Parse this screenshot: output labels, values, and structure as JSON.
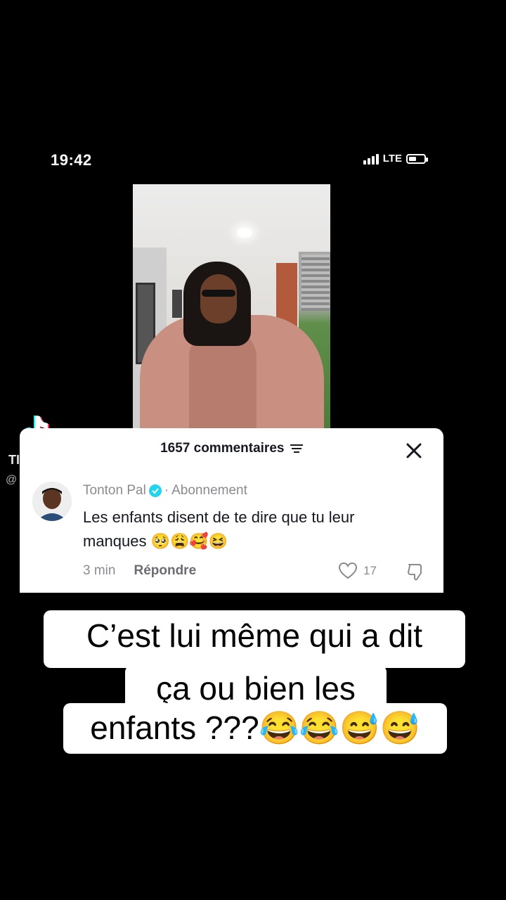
{
  "status_bar": {
    "time": "19:42",
    "network": "LTE",
    "battery_level": 0.5
  },
  "video": {
    "description_icon": "video-frame"
  },
  "tiktok": {
    "name": "TIKTOK",
    "handle": "@"
  },
  "comments": {
    "count_label": "1657 commentaires",
    "comment": {
      "author": "Tonton Pal",
      "separator": "·",
      "follow_label": "Abonnement",
      "line1": "Les enfants disent de te dire que tu leur",
      "line2": "manques 🥺😩🥰😆",
      "time": "3 min",
      "reply_label": "Répondre",
      "likes": "17"
    }
  },
  "caption": {
    "line1": "C’est lui même qui a dit",
    "line2": "ça ou bien les",
    "line3": "enfants ???😂😂😅😅"
  },
  "colors": {
    "verified": "#20d5ec",
    "card_bg": "#ffffff",
    "text": "#161823",
    "muted": "#8a8b91"
  }
}
